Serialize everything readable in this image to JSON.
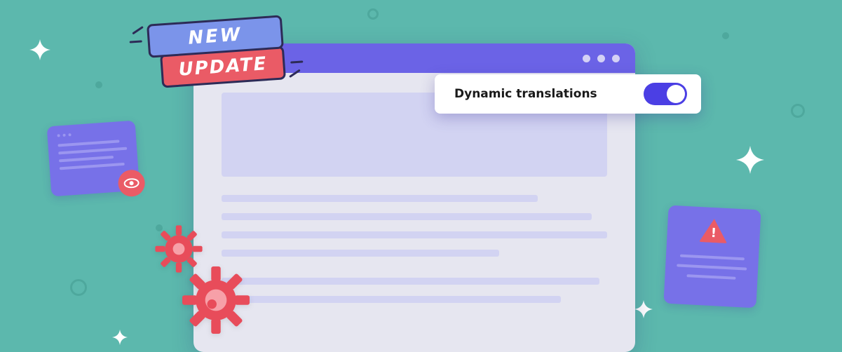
{
  "badge": {
    "new": "NEW",
    "update": "UPDATE"
  },
  "toggle": {
    "label": "Dynamic translations",
    "enabled": true
  },
  "colors": {
    "bg": "#5cb8ad",
    "accent": "#6b63e6",
    "danger": "#ea5b66"
  }
}
